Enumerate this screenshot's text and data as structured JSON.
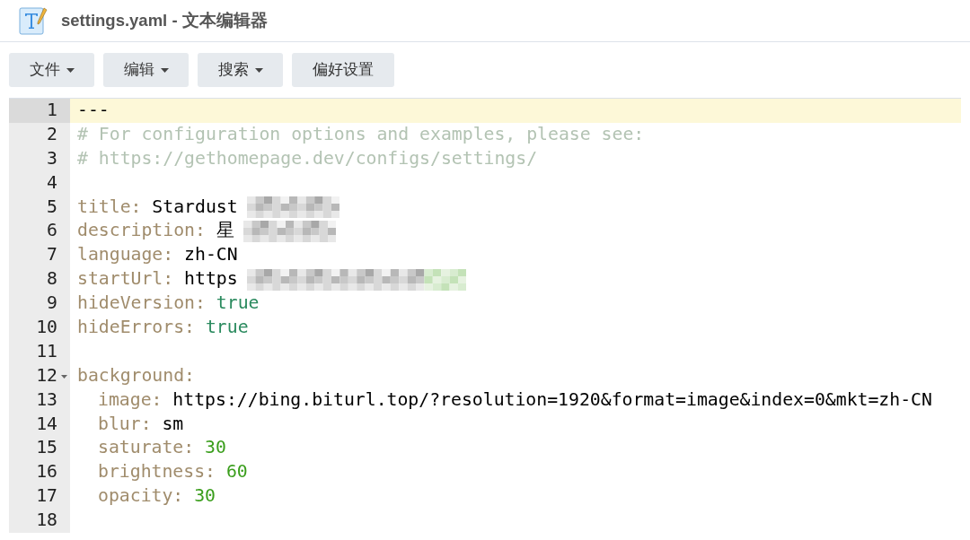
{
  "window": {
    "title": "settings.yaml - 文本编辑器"
  },
  "toolbar": [
    {
      "label": "文件",
      "dropdown": true
    },
    {
      "label": "编辑",
      "dropdown": true
    },
    {
      "label": "搜索",
      "dropdown": true
    },
    {
      "label": "偏好设置",
      "dropdown": false
    }
  ],
  "editor": {
    "lines": [
      {
        "number": "1",
        "active": true,
        "tokens": [
          {
            "kind": "plain",
            "text": "---"
          }
        ]
      },
      {
        "number": "2",
        "active": false,
        "tokens": [
          {
            "kind": "comment",
            "text": "# For configuration options and examples, please see:"
          }
        ]
      },
      {
        "number": "3",
        "active": false,
        "tokens": [
          {
            "kind": "comment",
            "text": "# https://gethomepage.dev/configs/settings/"
          }
        ]
      },
      {
        "number": "4",
        "active": false
      },
      {
        "number": "5",
        "active": false,
        "tokens": [
          {
            "kind": "key",
            "text": "title:"
          },
          {
            "kind": "plain",
            "text": "Stardust"
          },
          {
            "kind": "mosaic"
          }
        ]
      },
      {
        "number": "6",
        "active": false,
        "tokens": [
          {
            "kind": "key",
            "text": "description:"
          },
          {
            "kind": "plain",
            "text": "星"
          },
          {
            "kind": "mosaic"
          }
        ]
      },
      {
        "number": "7",
        "active": false,
        "tokens": [
          {
            "kind": "key",
            "text": "language:"
          },
          {
            "kind": "plain",
            "text": "zh-CN"
          }
        ]
      },
      {
        "number": "8",
        "active": false,
        "tokens": [
          {
            "kind": "key",
            "text": "startUrl:"
          },
          {
            "kind": "plain",
            "text": "https"
          },
          {
            "kind": "mosaic_wide"
          }
        ]
      },
      {
        "number": "9",
        "active": false,
        "tokens": [
          {
            "kind": "key",
            "text": "hideVersion:"
          },
          {
            "kind": "bool",
            "text": "true"
          }
        ]
      },
      {
        "number": "10",
        "active": false,
        "tokens": [
          {
            "kind": "key",
            "text": "hideErrors:"
          },
          {
            "kind": "bool",
            "text": "true"
          }
        ]
      },
      {
        "number": "11",
        "active": false
      },
      {
        "number": "12",
        "active": false,
        "tokens": [
          {
            "kind": "key",
            "text": "background:"
          }
        ],
        "children": [
          {
            "number": "13",
            "active": false,
            "tokens": [
              {
                "kind": "key",
                "text": "image:"
              },
              {
                "kind": "plain",
                "text": "https://bing.biturl.top/?resolution=1920&format=image&index=0&mkt=zh-CN"
              }
            ]
          },
          {
            "number": "14",
            "active": false,
            "tokens": [
              {
                "kind": "key",
                "text": "blur:"
              },
              {
                "kind": "plain",
                "text": "sm"
              }
            ]
          },
          {
            "number": "15",
            "active": false,
            "tokens": [
              {
                "kind": "key",
                "text": "saturate:"
              },
              {
                "kind": "number",
                "text": "30"
              }
            ]
          },
          {
            "number": "16",
            "active": false,
            "tokens": [
              {
                "kind": "key",
                "text": "brightness:"
              },
              {
                "kind": "number",
                "text": "60"
              }
            ]
          },
          {
            "number": "17",
            "active": false,
            "tokens": [
              {
                "kind": "key",
                "text": "opacity:"
              },
              {
                "kind": "number",
                "text": "30"
              }
            ]
          }
        ]
      },
      {
        "number": "18",
        "active": false
      }
    ]
  }
}
